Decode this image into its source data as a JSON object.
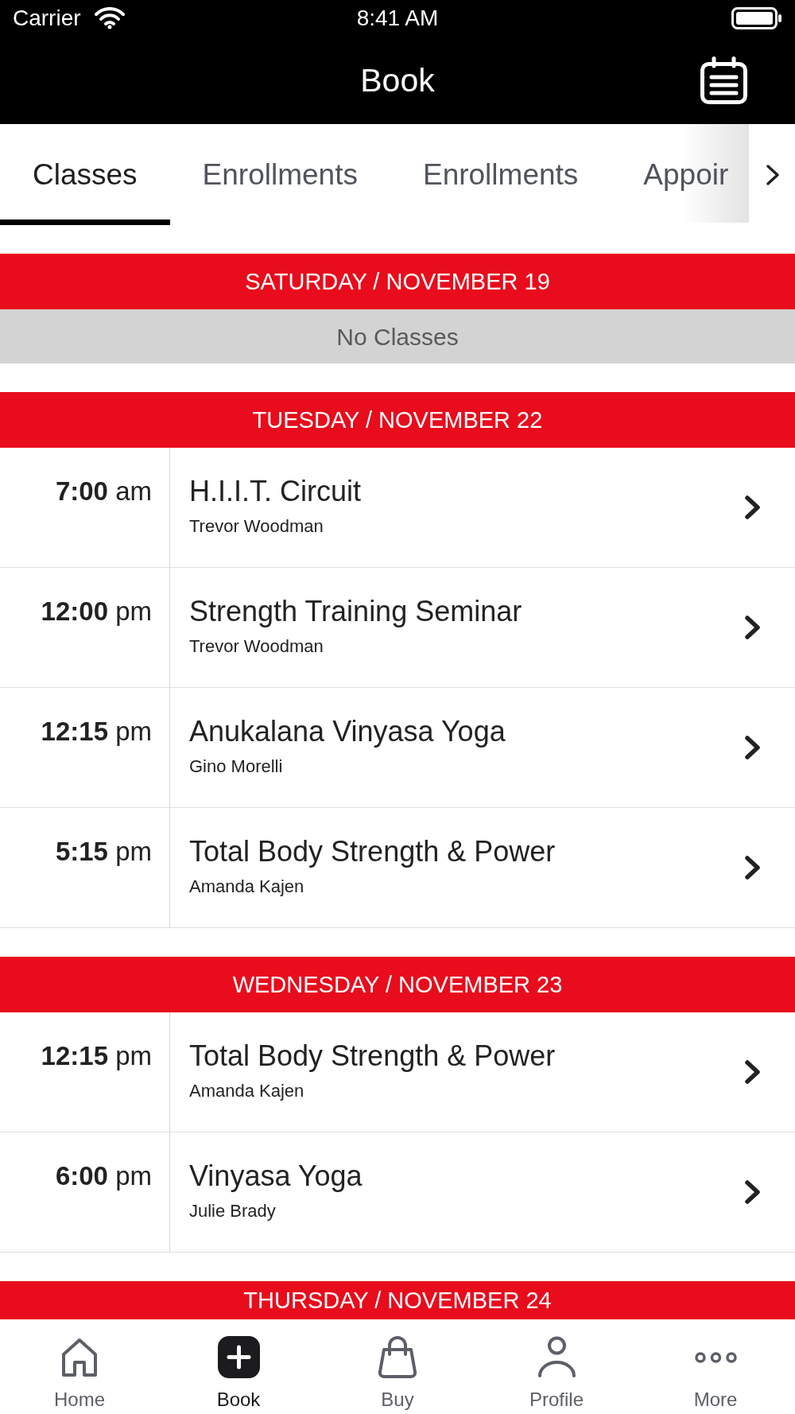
{
  "status_bar": {
    "carrier": "Carrier",
    "time": "8:41 AM"
  },
  "nav_bar": {
    "title": "Book"
  },
  "tabs": [
    {
      "label": "Classes",
      "selected": true
    },
    {
      "label": "Enrollments",
      "selected": false
    },
    {
      "label": "Enrollments",
      "selected": false
    },
    {
      "label": "Appoir",
      "selected": false
    }
  ],
  "schedule": [
    {
      "heading": "SATURDAY / NOVEMBER 19",
      "empty_message": "No Classes"
    },
    {
      "heading": "TUESDAY / NOVEMBER 22",
      "classes": [
        {
          "time": "**7:00** am",
          "name": "H.I.I.T. Circuit",
          "instructor": "Trevor Woodman"
        },
        {
          "time": "**12:00** pm",
          "name": "Strength Training Seminar",
          "instructor": "Trevor Woodman"
        },
        {
          "time": "**12:15** pm",
          "name": "Anukalana Vinyasa Yoga",
          "instructor": "Gino Morelli"
        },
        {
          "time": "**5:15** pm",
          "name": "Total Body Strength & Power",
          "instructor": "Amanda Kajen"
        }
      ]
    },
    {
      "heading": "WEDNESDAY / NOVEMBER 23",
      "classes": [
        {
          "time": "**12:15** pm",
          "name": "Total Body Strength & Power",
          "instructor": "Amanda Kajen"
        },
        {
          "time": "**6:00** pm",
          "name": "Vinyasa Yoga",
          "instructor": "Julie Brady"
        }
      ]
    },
    {
      "heading": "THURSDAY / NOVEMBER 24"
    }
  ],
  "bottom_tabs": [
    {
      "label": "Home",
      "selected": false
    },
    {
      "label": "Book",
      "selected": true
    },
    {
      "label": "Buy",
      "selected": false
    },
    {
      "label": "Profile",
      "selected": false
    },
    {
      "label": "More",
      "selected": false
    }
  ]
}
